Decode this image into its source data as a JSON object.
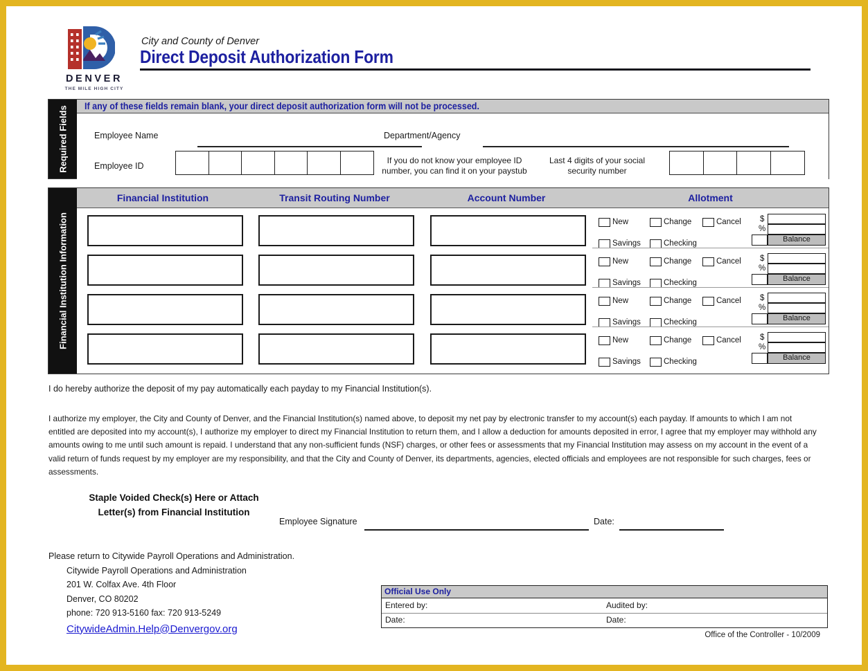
{
  "header": {
    "logo": {
      "wordmark": "DENVER",
      "tagline": "THE MILE HIGH CITY",
      "colors": {
        "building": "#b5312b",
        "sun": "#f0b323",
        "rays": "#3c7fbf",
        "mountain": "#4a2160",
        "d_shape": "#2f5fa8"
      }
    },
    "subtitle": "City and County of Denver",
    "title": "Direct Deposit Authorization Form"
  },
  "required_section": {
    "tab_label": "Required Fields",
    "banner": "If any of these fields remain blank, your direct deposit authorization form will not be processed.",
    "employee_name_label": "Employee Name",
    "department_label": "Department/Agency",
    "employee_id_label": "Employee ID",
    "employee_id_cells": 6,
    "employee_id_hint": "If you do not know your employee ID number, you can find it on your paystub",
    "ssn_label": "Last 4 digits of your social security number",
    "ssn_cells": 4
  },
  "financial_section": {
    "tab_label": "Financial Institution Information",
    "columns": [
      "Financial Institution",
      "Transit Routing Number",
      "Account Number",
      "Allotment"
    ],
    "rows": [
      {
        "financial_institution": "",
        "transit_routing_number": "",
        "account_number": "",
        "allotment": {
          "action_options": [
            "New",
            "Change",
            "Cancel"
          ],
          "account_type_options": [
            "Savings",
            "Checking"
          ],
          "dollar_symbol": "$",
          "percent_symbol": "%",
          "balance_label": "Balance",
          "amount_value": "",
          "percent_value": ""
        }
      },
      {
        "financial_institution": "",
        "transit_routing_number": "",
        "account_number": "",
        "allotment": {
          "action_options": [
            "New",
            "Change",
            "Cancel"
          ],
          "account_type_options": [
            "Savings",
            "Checking"
          ],
          "dollar_symbol": "$",
          "percent_symbol": "%",
          "balance_label": "Balance",
          "amount_value": "",
          "percent_value": ""
        }
      },
      {
        "financial_institution": "",
        "transit_routing_number": "",
        "account_number": "",
        "allotment": {
          "action_options": [
            "New",
            "Change",
            "Cancel"
          ],
          "account_type_options": [
            "Savings",
            "Checking"
          ],
          "dollar_symbol": "$",
          "percent_symbol": "%",
          "balance_label": "Balance",
          "amount_value": "",
          "percent_value": ""
        }
      },
      {
        "financial_institution": "",
        "transit_routing_number": "",
        "account_number": "",
        "allotment": {
          "action_options": [
            "New",
            "Change",
            "Cancel"
          ],
          "account_type_options": [
            "Savings",
            "Checking"
          ],
          "dollar_symbol": "$",
          "percent_symbol": "%",
          "balance_label": "Balance",
          "amount_value": "",
          "percent_value": ""
        }
      }
    ]
  },
  "legal": {
    "line1": "I do hereby authorize the deposit of my pay automatically each payday to my Financial Institution(s).",
    "paragraph": "I authorize my employer, the City and County of Denver, and the Financial Institution(s) named above, to deposit my net pay by electronic transfer to my account(s) each payday. If amounts to which I am not entitled are deposited into my account(s), I authorize my employer to direct my Financial Institution to return them, and I allow a deduction for amounts deposited in error, I agree that my employer may withhold any amounts owing to me until such amount is repaid. I understand that any non-sufficient funds (NSF) charges, or other fees or assessments that my Financial Institution may assess on my account in the event of a valid return of funds request by my employer are my responsibility, and that the City and County of Denver, its departments, agencies, elected officials and employees are not responsible for such charges, fees or assessments."
  },
  "signature_section": {
    "staple_line1": "Staple Voided Check(s) Here or Attach",
    "staple_line2": "Letter(s) from Financial Institution",
    "signature_label": "Employee Signature",
    "signature_value": "",
    "date_label": "Date:",
    "date_value": ""
  },
  "return_address": {
    "intro": "Please return to Citywide Payroll Operations and Administration.",
    "org": "Citywide Payroll Operations and Administration",
    "street": "201 W. Colfax Ave. 4th Floor",
    "city_state_zip": "Denver, CO 80202",
    "phone_fax": "phone: 720 913-5160      fax: 720 913-5249",
    "email": "CitywideAdmin.Help@Denvergov.org"
  },
  "official_use": {
    "title": "Official Use Only",
    "entered_by_label": "Entered by:",
    "entered_by_value": "",
    "audited_by_label": "Audited by:",
    "audited_by_value": "",
    "entered_date_label": "Date:",
    "entered_date_value": "",
    "audited_date_label": "Date:",
    "audited_date_value": ""
  },
  "footer": {
    "note": "Office of the Controller - 10/2009"
  }
}
